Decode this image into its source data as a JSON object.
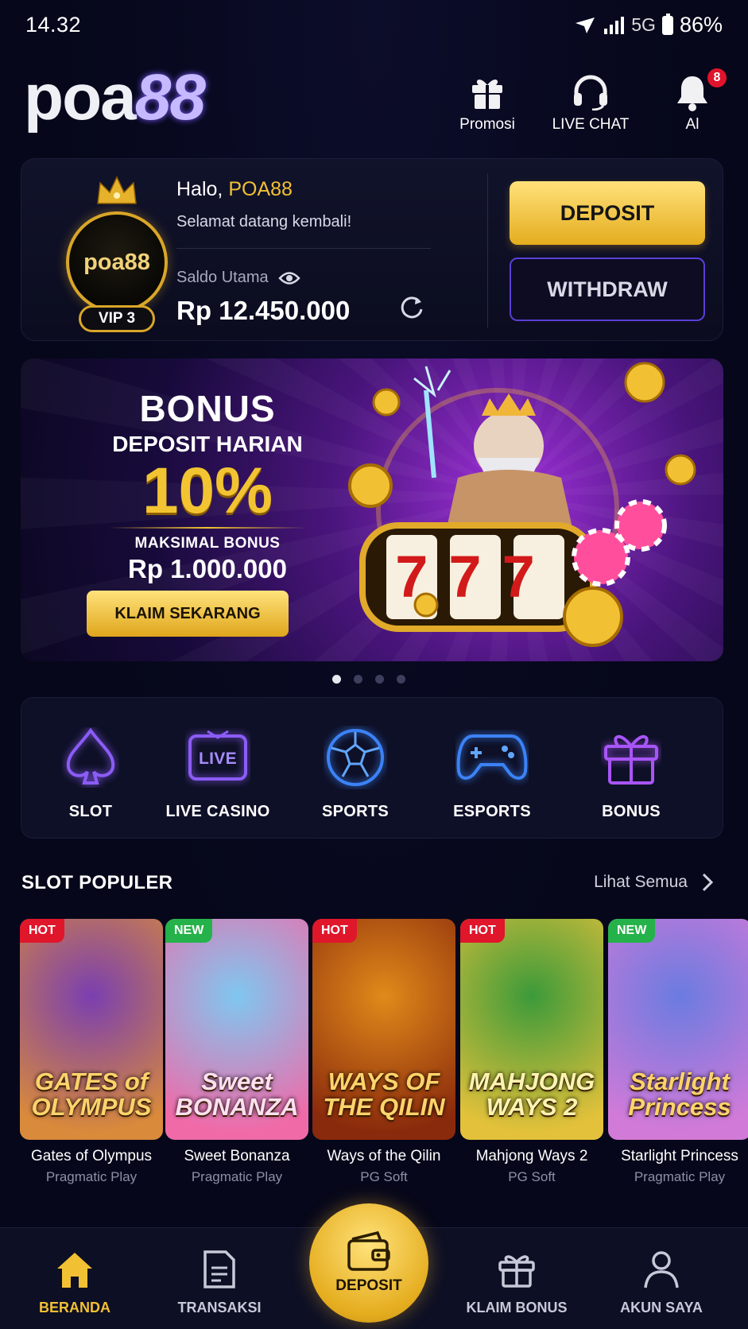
{
  "status_bar": {
    "time": "14.32",
    "network": "5G",
    "battery": "86%"
  },
  "header": {
    "logo_light": "poa",
    "logo_accent": "88",
    "promo_label": "Promosi",
    "chat_label": "LIVE CHAT",
    "alert_label": "Al",
    "alert_count": "8"
  },
  "account": {
    "avatar_text": "poa88",
    "vip": "VIP 3",
    "greeting": "Halo,",
    "username": "POA88",
    "welcome": "Selamat datang kembali!",
    "balance_label": "Saldo Utama",
    "balance": "Rp 12.450.000",
    "deposit_label": "DEPOSIT",
    "withdraw_label": "WITHDRAW"
  },
  "banner": {
    "title": "BONUS",
    "subtitle": "DEPOSIT HARIAN",
    "percent": "10%",
    "max_label": "MAKSIMAL BONUS",
    "max_value": "Rp 1.000.000",
    "cta": "KLAIM SEKARANG",
    "slot_digits": "777",
    "slides": 4,
    "active_slide": 1
  },
  "categories": [
    {
      "label": "SLOT",
      "icon": "spade-icon"
    },
    {
      "label": "LIVE CASINO",
      "icon": "live-tv-icon"
    },
    {
      "label": "SPORTS",
      "icon": "soccer-ball-icon"
    },
    {
      "label": "ESPORTS",
      "icon": "gamepad-icon"
    },
    {
      "label": "BONUS",
      "icon": "gift-icon"
    }
  ],
  "slot_section": {
    "title": "SLOT POPULER",
    "see_all": "Lihat Semua"
  },
  "games": [
    {
      "tag": "HOT",
      "art_title": "GATES of OLYMPUS",
      "title": "Gates of Olympus",
      "provider": "Pragmatic Play",
      "colors": [
        "#7a3fb0",
        "#d98a3a"
      ]
    },
    {
      "tag": "NEW",
      "art_title": "Sweet BONANZA",
      "title": "Sweet Bonanza",
      "provider": "Pragmatic Play",
      "colors": [
        "#7fc7f0",
        "#f06aa8"
      ]
    },
    {
      "tag": "HOT",
      "art_title": "WAYS OF THE QILIN",
      "title": "Ways of the Qilin",
      "provider": "PG Soft",
      "colors": [
        "#e08a1a",
        "#8a2a0c"
      ]
    },
    {
      "tag": "HOT",
      "art_title": "MAHJONG WAYS 2",
      "title": "Mahjong Ways 2",
      "provider": "PG Soft",
      "colors": [
        "#3c9a3a",
        "#e3c13a"
      ]
    },
    {
      "tag": "NEW",
      "art_title": "Starlight Princess",
      "title": "Starlight Princess",
      "provider": "Pragmatic Play",
      "colors": [
        "#6b7be0",
        "#d27ad8"
      ]
    }
  ],
  "bottom_nav": {
    "home": "BERANDA",
    "transactions": "TRANSAKSI",
    "deposit": "DEPOSIT",
    "claim": "KLAIM BONUS",
    "account": "AKUN SAYA"
  },
  "colors": {
    "accent_gold": "#f2c033",
    "accent_purple": "#5a3fd6",
    "bg": "#06071a"
  }
}
